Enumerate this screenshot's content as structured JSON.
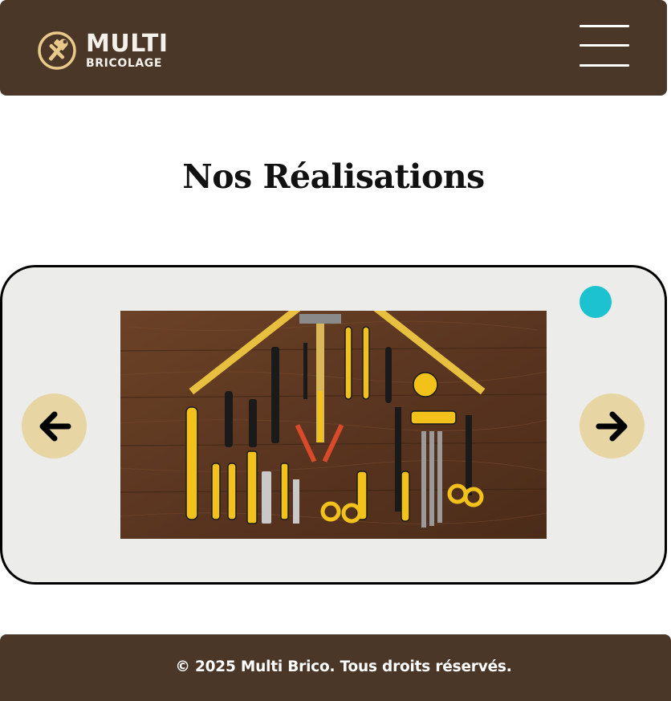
{
  "header": {
    "logo": {
      "main_text": "MULTI",
      "sub_text": "BRICOLAGE",
      "icon": "tools-icon",
      "accent_color": "#e8c98a"
    },
    "menu_icon": "hamburger-menu-icon",
    "background_color": "#4a3728"
  },
  "main": {
    "title": "Nos Réalisations",
    "carousel": {
      "image": "toolkit-photo",
      "prev_icon": "arrow-left-icon",
      "next_icon": "arrow-right-icon",
      "indicator_color": "#1dc2d0",
      "arrow_button_color": "#e8d5a4"
    }
  },
  "footer": {
    "text": "© 2025 Multi Brico. Tous droits réservés."
  }
}
